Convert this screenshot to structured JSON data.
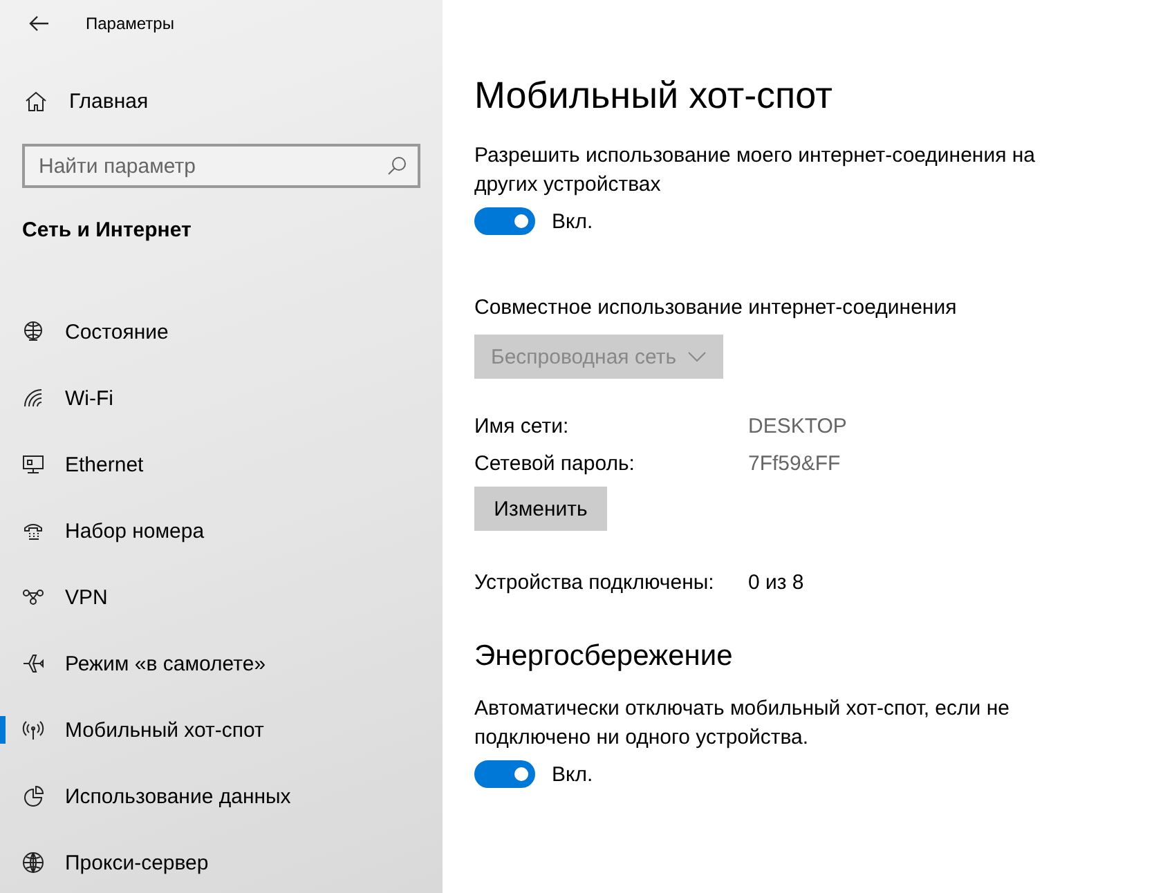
{
  "window": {
    "title": "Параметры"
  },
  "sidebar": {
    "home": "Главная",
    "search": {
      "placeholder": "Найти параметр"
    },
    "section": "Сеть и Интернет",
    "items": [
      {
        "label": "Состояние",
        "selected": false
      },
      {
        "label": "Wi-Fi",
        "selected": false
      },
      {
        "label": "Ethernet",
        "selected": false
      },
      {
        "label": "Набор номера",
        "selected": false
      },
      {
        "label": "VPN",
        "selected": false
      },
      {
        "label": "Режим «в самолете»",
        "selected": false
      },
      {
        "label": "Мобильный хот-спот",
        "selected": true
      },
      {
        "label": "Использование данных",
        "selected": false
      },
      {
        "label": "Прокси-сервер",
        "selected": false
      }
    ]
  },
  "main": {
    "title": "Мобильный хот-спот",
    "share": {
      "description": "Разрешить использование моего интернет-соединения на других устройствах",
      "toggle": {
        "on": true,
        "label": "Вкл."
      }
    },
    "source": {
      "label": "Совместное использование интернет-соединения",
      "dropdown": {
        "value": "Беспроводная сеть",
        "disabled": true
      }
    },
    "info": [
      {
        "label": "Имя сети:",
        "value": "DESKTOP"
      },
      {
        "label": "Сетевой пароль:",
        "value": "7Ff59&FF"
      }
    ],
    "edit_button": "Изменить",
    "devices": {
      "label": "Устройства подключены:",
      "value": "0 из 8"
    },
    "power": {
      "heading": "Энергосбережение",
      "description": "Автоматически отключать мобильный хот-спот, если не подключено ни одного устройства.",
      "toggle": {
        "on": true,
        "label": "Вкл."
      }
    }
  }
}
